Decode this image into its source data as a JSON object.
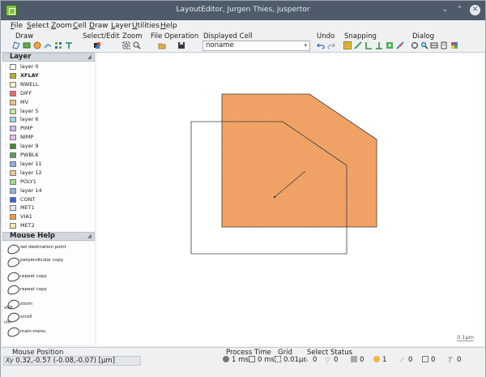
{
  "window": {
    "title": "LayoutEditor, Jurgen Thies, juspertor",
    "controls": [
      "⌄",
      "⌃",
      "✕"
    ]
  },
  "menu": [
    {
      "u": "F",
      "rest": "ile"
    },
    {
      "u": "S",
      "rest": "elect"
    },
    {
      "u": "Z",
      "rest": "oom"
    },
    {
      "u": "C",
      "rest": "ell"
    },
    {
      "u": "D",
      "rest": "raw"
    },
    {
      "u": "L",
      "rest": "ayer"
    },
    {
      "u": "U",
      "rest": "tilities"
    },
    {
      "u": "H",
      "rest": "elp"
    }
  ],
  "toolbar": {
    "groups": [
      "Draw",
      "Select/Edit",
      "Zoom",
      "File Operation",
      "Displayed Cell",
      "Undo",
      "Snapping",
      "Dialog"
    ],
    "displayed_cell": "noname"
  },
  "layers_panel": {
    "title": "Layer",
    "layers": [
      {
        "name": "layer 0",
        "color": "#ffffff",
        "bold": false
      },
      {
        "name": "XFLAY",
        "color": "#b9b422",
        "bold": true
      },
      {
        "name": "NWELL",
        "color": "#f4f2d0",
        "bold": false
      },
      {
        "name": "DIFF",
        "color": "#e86a6a",
        "bold": false
      },
      {
        "name": "MV",
        "color": "#f2c27a",
        "bold": false
      },
      {
        "name": "layer 5",
        "color": "#c9e59b",
        "bold": false
      },
      {
        "name": "layer 6",
        "color": "#9fd9e6",
        "bold": false
      },
      {
        "name": "PIMP",
        "color": "#c7b9ee",
        "bold": false
      },
      {
        "name": "NIMP",
        "color": "#f3b6ea",
        "bold": false
      },
      {
        "name": "layer 9",
        "color": "#3f8a2c",
        "bold": false
      },
      {
        "name": "PWBLK",
        "color": "#5aa157",
        "bold": false
      },
      {
        "name": "layer 11",
        "color": "#8fa7e8",
        "bold": false
      },
      {
        "name": "layer 12",
        "color": "#f0c48a",
        "bold": false
      },
      {
        "name": "POLY1",
        "color": "#9ce08d",
        "bold": false
      },
      {
        "name": "layer 14",
        "color": "#8eb7d9",
        "bold": false
      },
      {
        "name": "CONT",
        "color": "#3a5fd8",
        "bold": false
      },
      {
        "name": "MET1",
        "color": "#dfe9f3",
        "bold": false
      },
      {
        "name": "VIA1",
        "color": "#f29b3f",
        "bold": false
      },
      {
        "name": "MET2",
        "color": "#f6e6a6",
        "bold": false
      }
    ]
  },
  "mouse_help": {
    "title": "Mouse Help",
    "items": [
      "set destination point",
      "perpendicular copy",
      "repeat copy",
      "repeat copy",
      "zoom",
      "scroll",
      "main-menu"
    ],
    "side_labels": [
      "shift",
      "ctrl"
    ]
  },
  "canvas": {
    "scale_label": "0.1µm"
  },
  "status": {
    "mouse_position_label": "Mouse Position",
    "mouse_position_prefix": "Xy",
    "mouse_position": "0.32,-0.57 (-0.08,-0.07) [µm]",
    "process_time_label": "Process Time",
    "process_time_a": "1 ms",
    "process_time_b": "0 ms",
    "grid_label": "Grid",
    "grid_value": "0.01µr",
    "select_status_label": "Select Status",
    "counts": [
      "0",
      "0",
      "0",
      "1",
      "0",
      "0",
      "0"
    ]
  },
  "colors": {
    "shape_fill": "#f3a66a",
    "shape_stroke": "#3b3b3b",
    "titlebar": "#4d5b6b"
  },
  "icons": {
    "draw": [
      "polygon-icon",
      "box-icon",
      "circle-icon",
      "wire-icon",
      "path-icon",
      "text-icon"
    ],
    "select": [
      "select-icon"
    ],
    "zoom": [
      "zoom-fit-icon",
      "zoom-in-icon"
    ],
    "file": [
      "open-icon",
      "save-icon"
    ],
    "undo": [
      "undo-icon",
      "redo-icon"
    ],
    "snapping": [
      "snap-grid-icon",
      "snap-45-icon",
      "snap-90-icon",
      "snap-any-icon",
      "snap-point-icon",
      "snap-edge-icon"
    ],
    "dialog": [
      "properties-icon",
      "find-icon",
      "layers-dialog-icon",
      "cell-icon",
      "settings-icon"
    ]
  }
}
